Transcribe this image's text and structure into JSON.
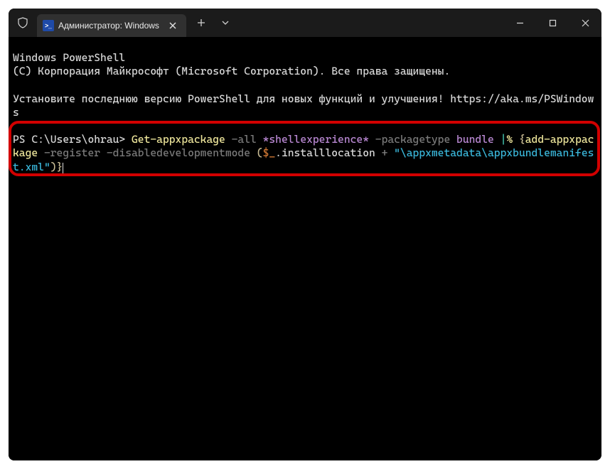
{
  "titlebar": {
    "tab_title": "Администратор: Windows Pc"
  },
  "terminal": {
    "line1": "Windows PowerShell",
    "line2": "(C) Корпорация Майкрософт (Microsoft Corporation). Все права защищены.",
    "line3": "Установите последнюю версию PowerShell для новых функций и улучшения! https://aka.ms/PSWindows",
    "prompt": "PS C:\\Users\\ohrau> ",
    "cmd": {
      "t1": "Get-appxpackage",
      "t2": " -all ",
      "t3": "*shellexperience*",
      "t4": " -packagetype ",
      "t5": "bundle ",
      "t6": "|",
      "t7": "% ",
      "t8": "{",
      "t9": "add-appxpackage",
      "t10": " -register -disabledevelopmentmode ",
      "t11": "(",
      "t12": "$_",
      "t13": ".installlocation ",
      "t14": "+ ",
      "t15": "\"\\appxmetadata\\appxbundlemanifest.xml\"",
      "t16": ")",
      "t17": "}"
    }
  }
}
